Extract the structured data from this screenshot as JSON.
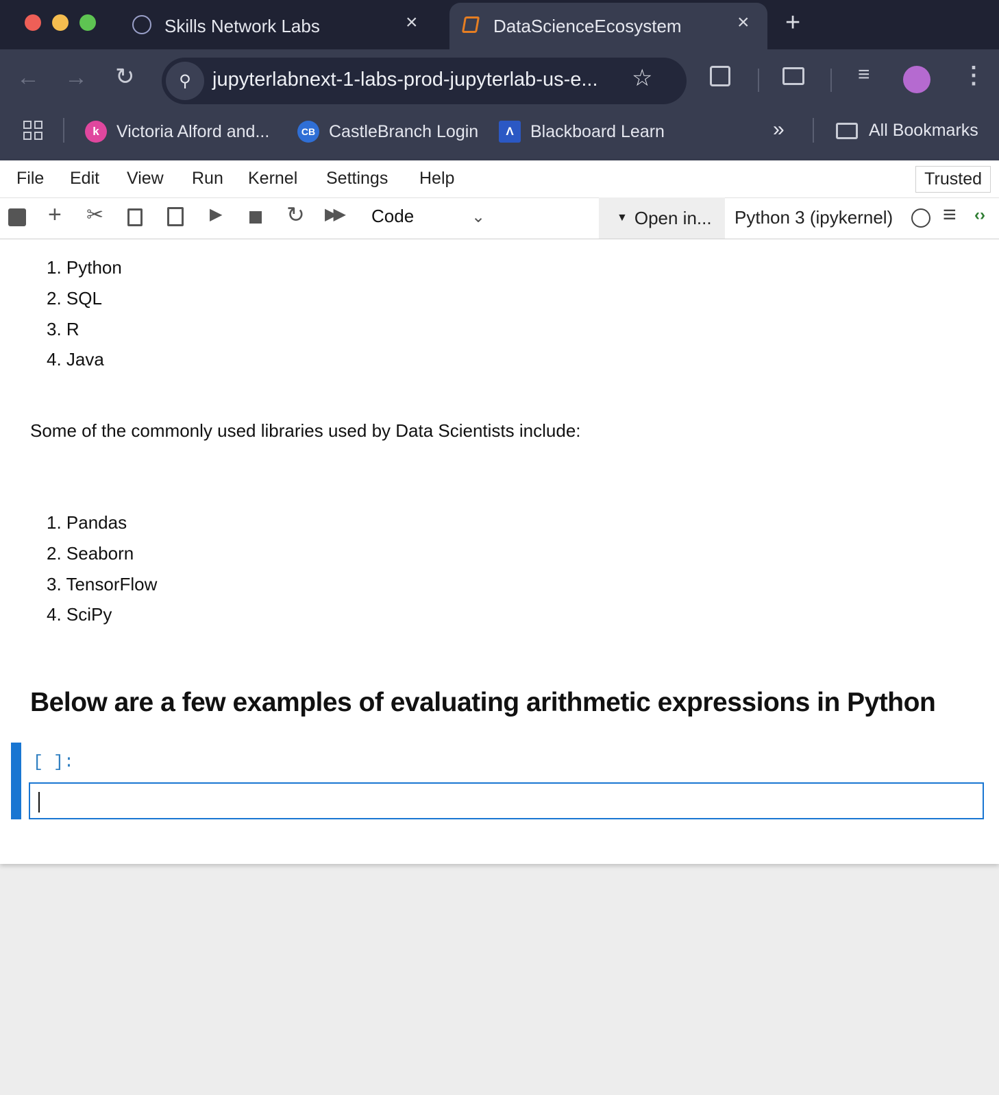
{
  "browser": {
    "tabs": [
      {
        "title": "Skills Network Labs",
        "active": false
      },
      {
        "title": "DataScienceEcosystem",
        "active": true
      }
    ],
    "url": "jupyterlabnext-1-labs-prod-jupyterlab-us-e...",
    "bookmarks": [
      {
        "label": "Victoria Alford and..."
      },
      {
        "label": "CastleBranch Login"
      },
      {
        "label": "Blackboard Learn"
      }
    ],
    "all_bookmarks": "All Bookmarks"
  },
  "jupyter": {
    "menu": [
      "File",
      "Edit",
      "View",
      "Run",
      "Kernel",
      "Settings",
      "Help"
    ],
    "trusted": "Trusted",
    "cell_type": "Code",
    "open_in": "Open in...",
    "kernel": "Python 3 (ipykernel)"
  },
  "notebook": {
    "languages": [
      "1. Python",
      "2. SQL",
      "3. R",
      "4. Java"
    ],
    "libraries_intro": "Some of the commonly used libraries used by Data Scientists include:",
    "libraries": [
      "1. Pandas",
      "2. Seaborn",
      "3. TensorFlow",
      "4. SciPy"
    ],
    "heading": "Below are a few examples of evaluating arithmetic expressions in Python",
    "prompt": "[ ]:"
  },
  "colors": {
    "titlebar": "#1f2233",
    "toolbar": "#383d50",
    "accent": "#1976d2"
  }
}
